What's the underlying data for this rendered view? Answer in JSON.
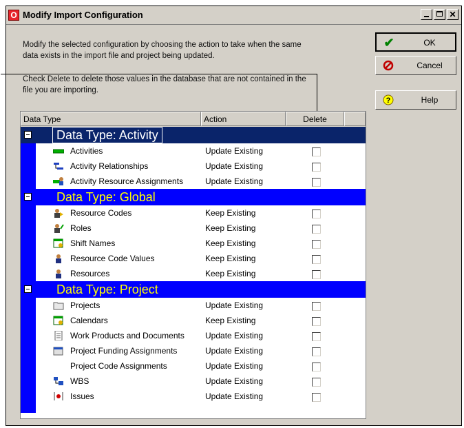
{
  "window": {
    "title": "Modify Import Configuration"
  },
  "instructions": {
    "line1": "Modify the selected configuration by choosing the action to take when the same",
    "line2": "data exists in the import file and project being updated.",
    "line3": "Check Delete to delete those values in the database that are not contained in the",
    "line4": "file you are importing."
  },
  "table": {
    "columns": {
      "data_type": "Data Type",
      "action": "Action",
      "delete": "Delete"
    },
    "groups": [
      {
        "title": "Data Type: Activity",
        "rows": [
          {
            "name": "Activities",
            "action": "Update Existing",
            "icon": "activities-icon"
          },
          {
            "name": "Activity Relationships",
            "action": "Update Existing",
            "icon": "relationships-icon"
          },
          {
            "name": "Activity Resource Assignments",
            "action": "Update Existing",
            "icon": "resource-assignments-icon"
          }
        ]
      },
      {
        "title": "Data Type: Global",
        "rows": [
          {
            "name": "Resource Codes",
            "action": "Keep Existing",
            "icon": "resource-codes-icon"
          },
          {
            "name": "Roles",
            "action": "Keep Existing",
            "icon": "roles-icon"
          },
          {
            "name": "Shift Names",
            "action": "Keep Existing",
            "icon": "calendar-icon"
          },
          {
            "name": "Resource Code Values",
            "action": "Keep Existing",
            "icon": "person-icon"
          },
          {
            "name": "Resources",
            "action": "Keep Existing",
            "icon": "person-icon"
          }
        ]
      },
      {
        "title": "Data Type: Project",
        "rows": [
          {
            "name": "Projects",
            "action": "Update Existing",
            "icon": "folder-icon"
          },
          {
            "name": "Calendars",
            "action": "Keep Existing",
            "icon": "calendar-icon"
          },
          {
            "name": "Work Products and Documents",
            "action": "Update Existing",
            "icon": "document-icon"
          },
          {
            "name": "Project Funding Assignments",
            "action": "Update Existing",
            "icon": "funding-icon"
          },
          {
            "name": "Project Code Assignments",
            "action": "Update Existing",
            "icon": ""
          },
          {
            "name": "WBS",
            "action": "Update Existing",
            "icon": "wbs-icon"
          },
          {
            "name": "Issues",
            "action": "Update Existing",
            "icon": "issues-icon"
          }
        ]
      }
    ]
  },
  "buttons": {
    "ok": "OK",
    "cancel": "Cancel",
    "help": "Help"
  },
  "colors": {
    "selected_band": "#0a246a",
    "group_band": "#0000ff",
    "group_text": "#ffff00"
  }
}
